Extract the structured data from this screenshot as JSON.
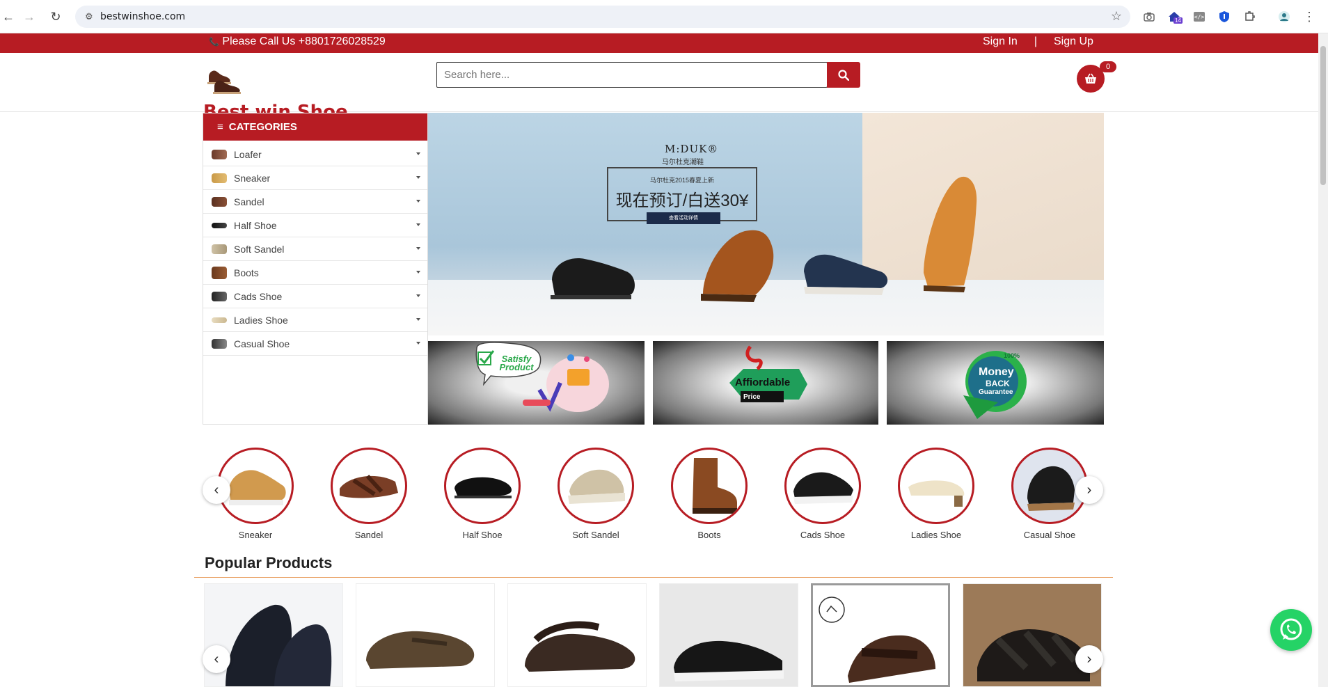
{
  "browser": {
    "url": "bestwinshoe.com",
    "extension_badge": "14"
  },
  "topbar": {
    "phone_icon": "phone-icon",
    "phone_text": "Please Call Us +8801726028529",
    "sign_in": "Sign In",
    "separator": "|",
    "sign_up": "Sign Up"
  },
  "header": {
    "logo_text": "Best win Shoe",
    "search_placeholder": "Search here...",
    "cart_count": "0"
  },
  "sidebar": {
    "title": "CATEGORIES",
    "items": [
      {
        "label": "Loafer"
      },
      {
        "label": "Sneaker"
      },
      {
        "label": "Sandel"
      },
      {
        "label": "Half Shoe"
      },
      {
        "label": "Soft Sandel"
      },
      {
        "label": "Boots"
      },
      {
        "label": "Cads Shoe"
      },
      {
        "label": "Ladies Shoe"
      },
      {
        "label": "Casual Shoe"
      }
    ]
  },
  "banner": {
    "brand": "M:DUK®",
    "brand_sub": "马尔杜克潮鞋",
    "promo_small": "马尔杜克2015春夏上新",
    "promo_big": "现在预订/白送30¥",
    "promo_button": "查看活动详情"
  },
  "tiles": {
    "satisfy_text": "Satisfy Product",
    "affordable_text": "Affiordable",
    "affordable_sub": "Price",
    "money_top": "100%",
    "money_main": "Money",
    "money_back": "BACK",
    "money_guarantee": "Guarantee"
  },
  "circle_categories": [
    {
      "label": "Sneaker"
    },
    {
      "label": "Sandel"
    },
    {
      "label": "Half Shoe"
    },
    {
      "label": "Soft Sandel"
    },
    {
      "label": "Boots"
    },
    {
      "label": "Cads Shoe"
    },
    {
      "label": "Ladies Shoe"
    },
    {
      "label": "Casual Shoe"
    }
  ],
  "popular": {
    "title": "Popular Products"
  },
  "arrows": {
    "prev": "‹",
    "next": "›"
  },
  "colors": {
    "brand_red": "#b71c23",
    "whatsapp_green": "#25d366"
  }
}
